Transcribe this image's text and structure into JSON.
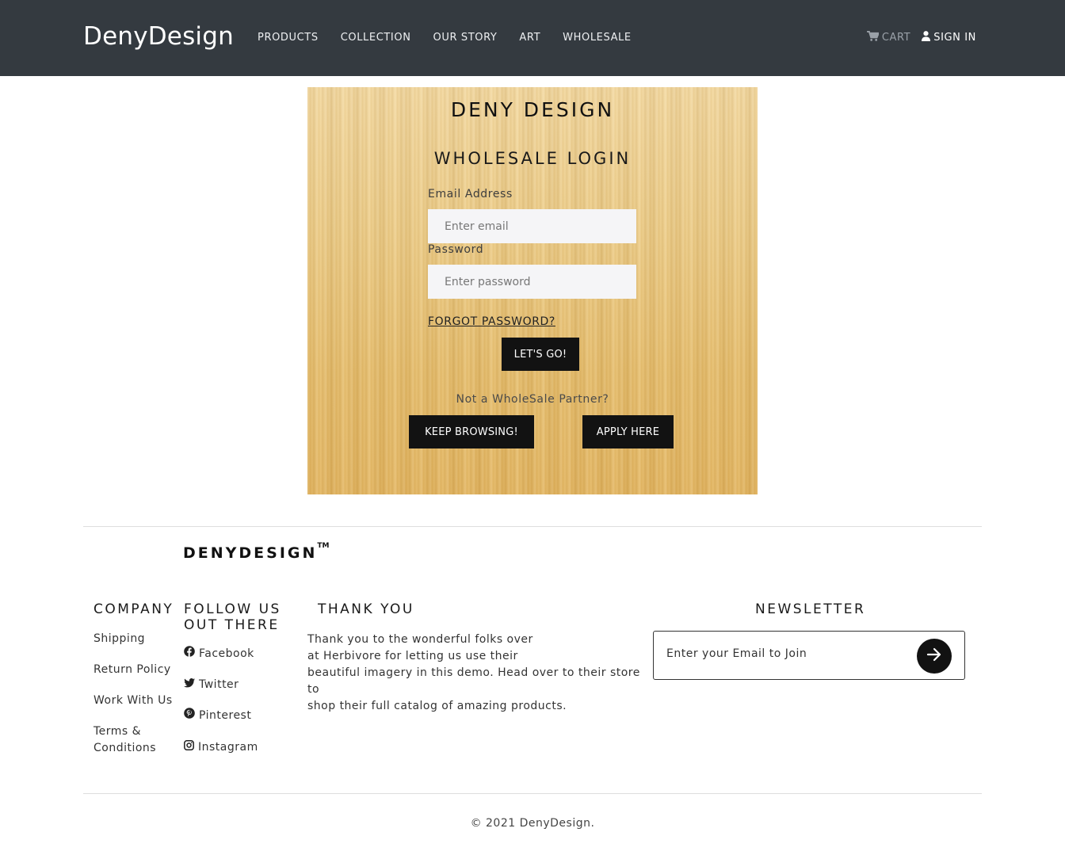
{
  "header": {
    "brand": "DenyDesign",
    "nav": [
      "PRODUCTS",
      "COLLECTION",
      "OUR STORY",
      "ART",
      "WHOLESALE"
    ],
    "cart_label": "CART",
    "signin_label": "SIGN IN"
  },
  "login": {
    "title": "DENY DESIGN",
    "subtitle": "WHOLESALE LOGIN",
    "email_label": "Email Address",
    "email_placeholder": "Enter email",
    "password_label": "Password",
    "password_placeholder": "Enter password",
    "forgot_label": "FORGOT PASSWORD?",
    "submit_label": "LET'S GO!",
    "partner_text": "Not a WholeSale Partner?",
    "browse_label": "KEEP BROWSING!",
    "apply_label": "APPLY HERE"
  },
  "footer": {
    "logo": "DENYDESIGN",
    "logo_tm": "TM",
    "company": {
      "heading": "COMPANY",
      "links": [
        "Shipping",
        "Return Policy",
        "Work With Us",
        "Terms &",
        "Conditions"
      ]
    },
    "follow": {
      "heading_line1": "FOLLOW US",
      "heading_line2": "OUT THERE",
      "links": [
        "Facebook",
        "Twitter",
        "Pinterest",
        "Instagram"
      ]
    },
    "thanks": {
      "heading": "THANK YOU",
      "lines": [
        "Thank you to the wonderful folks over",
        "at Herbivore for letting us use their",
        "beautiful imagery in this demo. Head over to their store to",
        "shop their full catalog of amazing products."
      ]
    },
    "newsletter": {
      "heading": "NEWSLETTER",
      "placeholder": "Enter your Email to Join"
    },
    "copyright": "© 2021 DenyDesign."
  },
  "colors": {
    "header_bg": "#343a40",
    "button_dark": "#121212",
    "wood": "#e8bf6d"
  }
}
